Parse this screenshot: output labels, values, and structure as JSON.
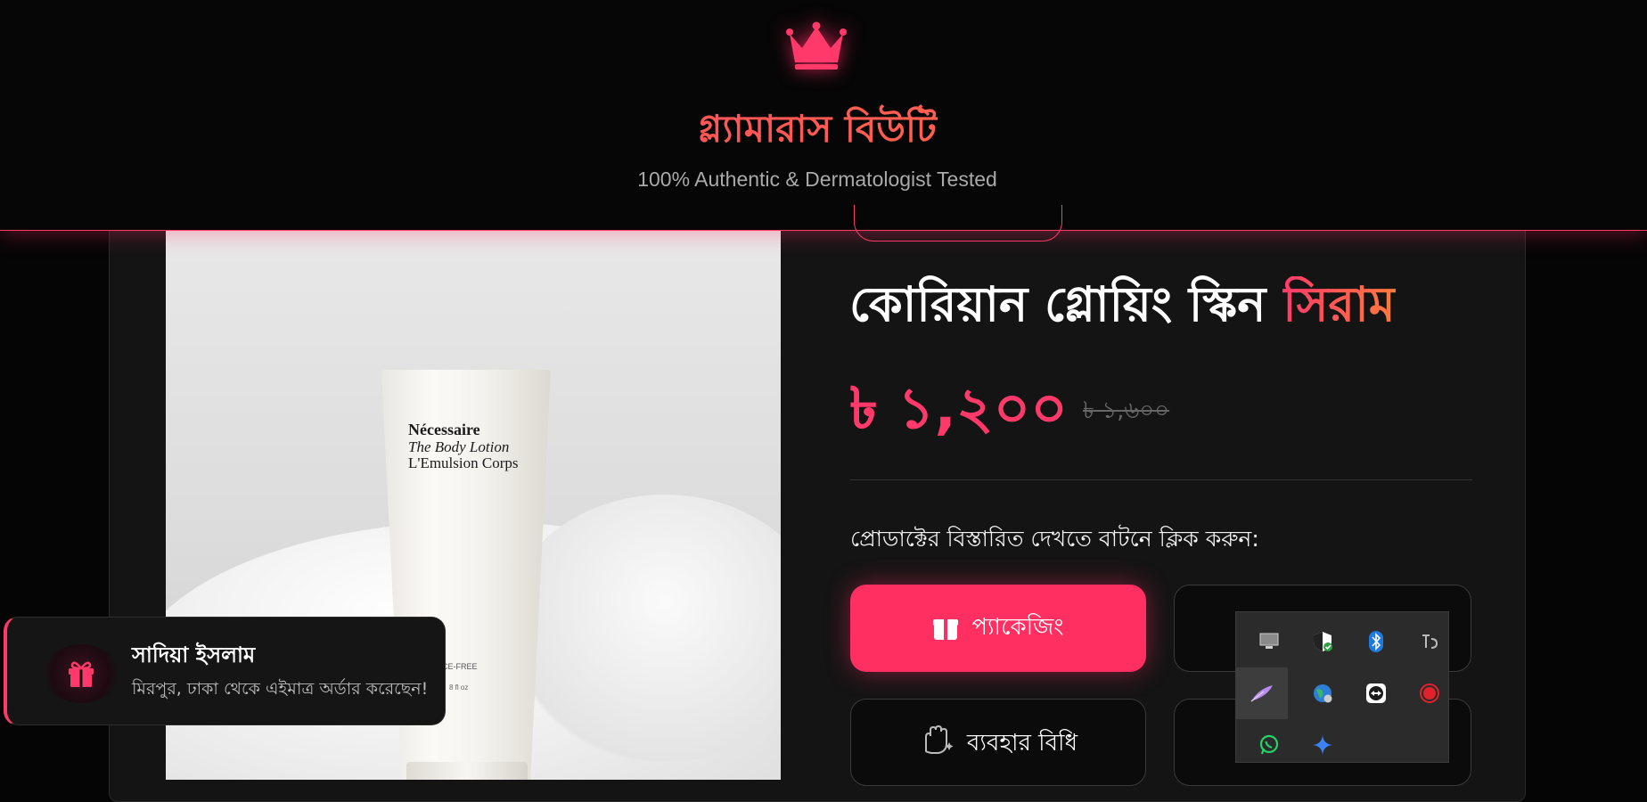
{
  "header": {
    "brand_title": "গ্ল্যামারাস বিউটি",
    "tagline": "100% Authentic & Dermatologist Tested"
  },
  "product": {
    "title_main": "কোরিয়ান গ্লোয়িং স্কিন ",
    "title_accent": "সিরাম",
    "price": "৳ ১,২০০",
    "old_price": "৳ ১,৬০০",
    "details_prompt": "প্রোডাক্টের বিস্তারিত দেখতে বাটনে ক্লিক করুন:",
    "image_text": {
      "brand": "Nécessaire",
      "line1": "The Body Lotion",
      "line2": "L'Emulsion Corps",
      "small1": "CE-FREE",
      "small2": "8 fl oz"
    }
  },
  "buttons": {
    "packaging": "প্যাকেজিং",
    "usage": "ব্যবহার বিধি"
  },
  "toast": {
    "name": "সাদিয়া ইসলাম",
    "message": "মিরপুর, ঢাকা থেকে এইমাত্র অর্ডার করেছেন!"
  },
  "tray": {
    "icons": [
      "display-icon",
      "windows-security-icon",
      "bluetooth-icon",
      "ime-icon",
      "quill-icon",
      "globe-icon",
      "teamviewer-icon",
      "record-icon",
      "whatsapp-icon",
      "sparkle-icon"
    ]
  },
  "colors": {
    "accent": "#ff3a6a",
    "accent_orange": "#ff7a3c",
    "background": "#050505",
    "card": "#141414"
  }
}
